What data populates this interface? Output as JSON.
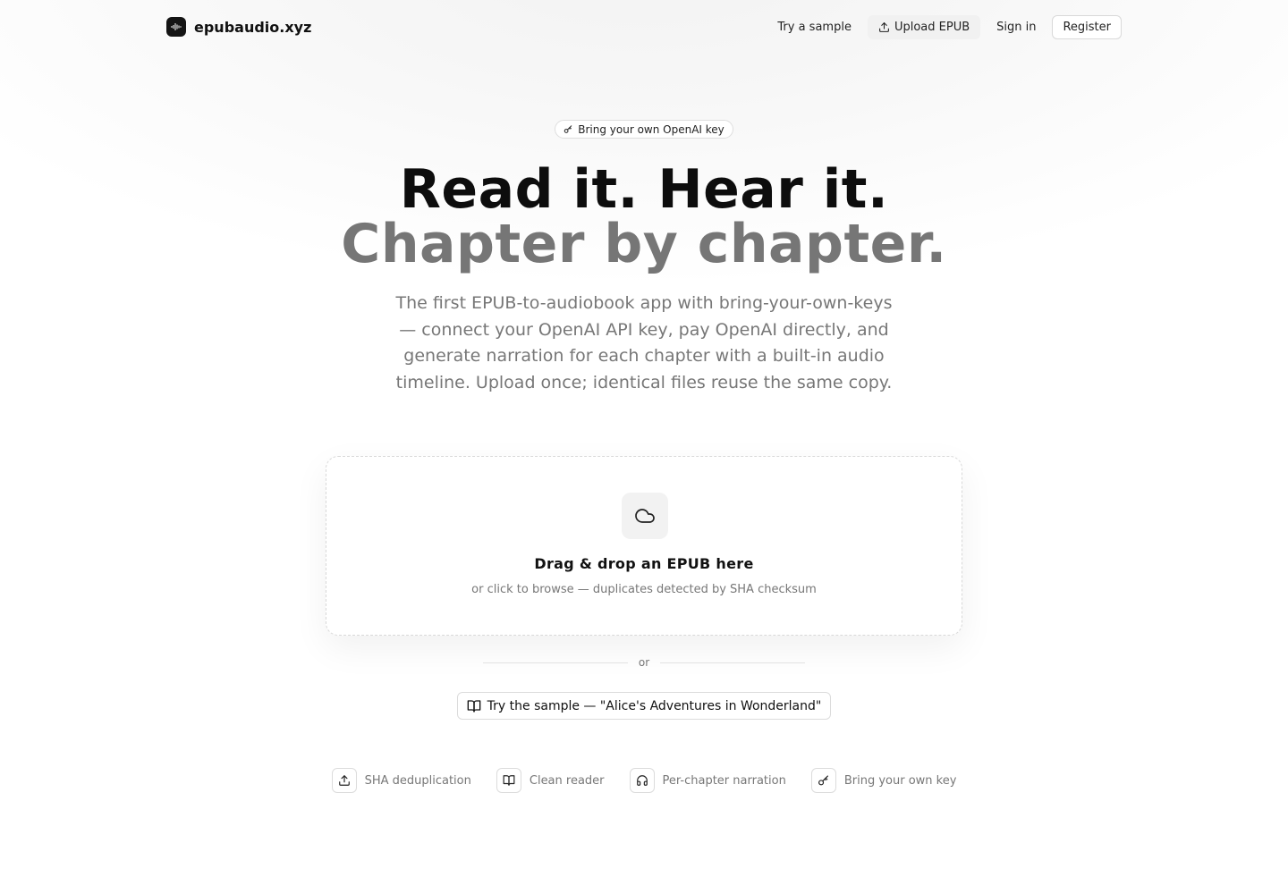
{
  "brand": {
    "name": "epubaudio.xyz",
    "logo_icon": "audio-waveform-icon"
  },
  "nav": {
    "try_sample": "Try a sample",
    "upload_epub": "Upload EPUB",
    "sign_in": "Sign in",
    "register": "Register"
  },
  "hero": {
    "badge": "Bring your own OpenAI key",
    "headline_line1": "Read it. Hear it.",
    "headline_line2": "Chapter by chapter.",
    "description": "The first EPUB-to-audiobook app with bring-your-own-keys — connect your OpenAI API key, pay OpenAI directly, and generate narration for each chapter with a built-in audio timeline. Upload once; identical files reuse the same copy."
  },
  "dropzone": {
    "icon": "cloud-icon",
    "title": "Drag & drop an EPUB here",
    "subtitle": "or click to browse — duplicates detected by SHA checksum"
  },
  "divider": {
    "label": "or"
  },
  "sample_button": {
    "label": "Try the sample — \"Alice's Adventures in Wonderland\"",
    "icon": "book-open-icon"
  },
  "features": [
    {
      "label": "SHA deduplication",
      "icon": "upload-icon"
    },
    {
      "label": "Clean reader",
      "icon": "book-open-icon"
    },
    {
      "label": "Per-chapter narration",
      "icon": "headphones-icon"
    },
    {
      "label": "Bring your own key",
      "icon": "key-icon"
    }
  ],
  "colors": {
    "text_primary": "#111111",
    "text_muted": "#777777",
    "headline_secondary": "#767676",
    "border": "#dcdcdc",
    "logo_bg": "#141414"
  }
}
